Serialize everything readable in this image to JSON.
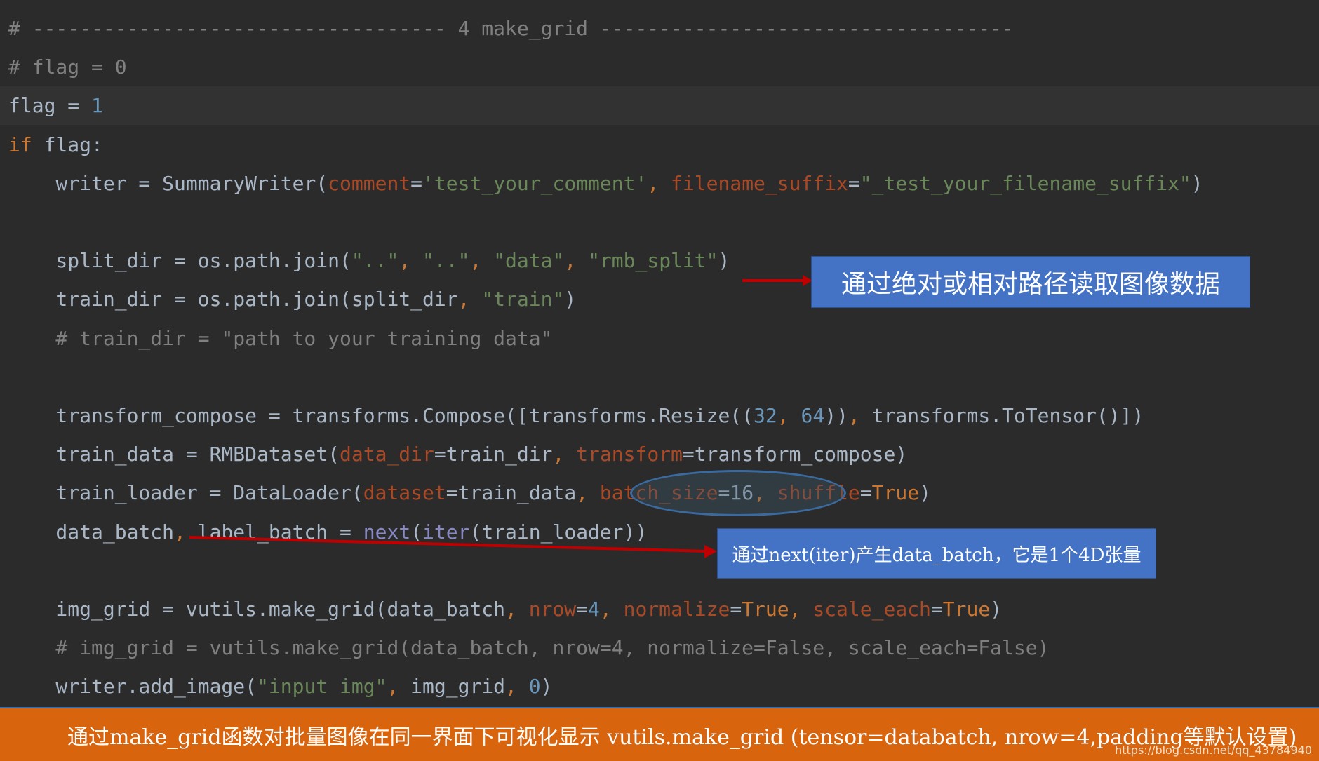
{
  "colors": {
    "background": "#2b2b2b",
    "current_line": "#323232",
    "default_text": "#a9b7c6",
    "comment": "#808080",
    "keyword": "#cc7832",
    "string": "#6a8759",
    "number": "#6897bb",
    "param": "#aa4926",
    "builtin": "#8888c6",
    "callout_blue": "#4472c4",
    "arrow_red": "#c00000",
    "banner_orange": "#d8640e"
  },
  "code_lines": [
    [
      {
        "t": "# ----------------------------------- 4 make_grid -----------------------------------",
        "c": "comment"
      }
    ],
    [
      {
        "t": "# flag = 0",
        "c": "comment"
      }
    ],
    [
      {
        "t": "flag",
        "c": "default"
      },
      {
        "t": " = ",
        "c": "default"
      },
      {
        "t": "1",
        "c": "number"
      }
    ],
    [
      {
        "t": "if ",
        "c": "keyword"
      },
      {
        "t": "flag:",
        "c": "default"
      }
    ],
    [
      {
        "t": "    writer = SummaryWriter(",
        "c": "default"
      },
      {
        "t": "comment",
        "c": "param"
      },
      {
        "t": "=",
        "c": "default"
      },
      {
        "t": "'test_your_comment'",
        "c": "string"
      },
      {
        "t": ", ",
        "c": "keyword"
      },
      {
        "t": "filename_suffix",
        "c": "param"
      },
      {
        "t": "=",
        "c": "default"
      },
      {
        "t": "\"_test_your_filename_suffix\"",
        "c": "string"
      },
      {
        "t": ")",
        "c": "default"
      }
    ],
    [],
    [
      {
        "t": "    split_dir = os.path.join(",
        "c": "default"
      },
      {
        "t": "\"..\"",
        "c": "string"
      },
      {
        "t": ", ",
        "c": "keyword"
      },
      {
        "t": "\"..\"",
        "c": "string"
      },
      {
        "t": ", ",
        "c": "keyword"
      },
      {
        "t": "\"data\"",
        "c": "string"
      },
      {
        "t": ", ",
        "c": "keyword"
      },
      {
        "t": "\"rmb_split\"",
        "c": "string"
      },
      {
        "t": ")",
        "c": "default"
      }
    ],
    [
      {
        "t": "    train_dir = os.path.join(split_dir",
        "c": "default"
      },
      {
        "t": ", ",
        "c": "keyword"
      },
      {
        "t": "\"train\"",
        "c": "string"
      },
      {
        "t": ")",
        "c": "default"
      }
    ],
    [
      {
        "t": "    # train_dir = \"path to your training data\"",
        "c": "comment"
      }
    ],
    [],
    [
      {
        "t": "    transform_compose = transforms.Compose([transforms.Resize((",
        "c": "default"
      },
      {
        "t": "32",
        "c": "number"
      },
      {
        "t": ", ",
        "c": "keyword"
      },
      {
        "t": "64",
        "c": "number"
      },
      {
        "t": "))",
        "c": "default"
      },
      {
        "t": ", ",
        "c": "keyword"
      },
      {
        "t": "transforms.ToTensor()])",
        "c": "default"
      }
    ],
    [
      {
        "t": "    train_data = RMBDataset(",
        "c": "default"
      },
      {
        "t": "data_dir",
        "c": "param"
      },
      {
        "t": "=train_dir",
        "c": "default"
      },
      {
        "t": ", ",
        "c": "keyword"
      },
      {
        "t": "transform",
        "c": "param"
      },
      {
        "t": "=transform_compose)",
        "c": "default"
      }
    ],
    [
      {
        "t": "    train_loader = DataLoader(",
        "c": "default"
      },
      {
        "t": "dataset",
        "c": "param"
      },
      {
        "t": "=train_data",
        "c": "default"
      },
      {
        "t": ", ",
        "c": "keyword"
      },
      {
        "t": "batch_size",
        "c": "param"
      },
      {
        "t": "=16",
        "c": "default"
      },
      {
        "t": ", ",
        "c": "keyword"
      },
      {
        "t": "shuffle",
        "c": "param"
      },
      {
        "t": "=",
        "c": "default"
      },
      {
        "t": "True",
        "c": "keyword"
      },
      {
        "t": ")",
        "c": "default"
      }
    ],
    [
      {
        "t": "    data_batch",
        "c": "default"
      },
      {
        "t": ", ",
        "c": "keyword"
      },
      {
        "t": "label_batch = ",
        "c": "default"
      },
      {
        "t": "next",
        "c": "builtin"
      },
      {
        "t": "(",
        "c": "default"
      },
      {
        "t": "iter",
        "c": "builtin"
      },
      {
        "t": "(train_loader))",
        "c": "default"
      }
    ],
    [],
    [
      {
        "t": "    img_grid = vutils.make_grid(data_batch",
        "c": "default"
      },
      {
        "t": ", ",
        "c": "keyword"
      },
      {
        "t": "nrow",
        "c": "param"
      },
      {
        "t": "=",
        "c": "default"
      },
      {
        "t": "4",
        "c": "number"
      },
      {
        "t": ", ",
        "c": "keyword"
      },
      {
        "t": "normalize",
        "c": "param"
      },
      {
        "t": "=",
        "c": "default"
      },
      {
        "t": "True",
        "c": "keyword"
      },
      {
        "t": ", ",
        "c": "keyword"
      },
      {
        "t": "scale_each",
        "c": "param"
      },
      {
        "t": "=",
        "c": "default"
      },
      {
        "t": "True",
        "c": "keyword"
      },
      {
        "t": ")",
        "c": "default"
      }
    ],
    [
      {
        "t": "    # img_grid = vutils.make_grid(data_batch, nrow=4, normalize=False, scale_each=False)",
        "c": "comment"
      }
    ],
    [
      {
        "t": "    writer.add_image(",
        "c": "default"
      },
      {
        "t": "\"input img\"",
        "c": "string"
      },
      {
        "t": ", ",
        "c": "keyword"
      },
      {
        "t": "img_grid",
        "c": "default"
      },
      {
        "t": ", ",
        "c": "keyword"
      },
      {
        "t": "0",
        "c": "number"
      },
      {
        "t": ")",
        "c": "default"
      }
    ]
  ],
  "callouts": {
    "read_images": "通过绝对或相对路径读取图像数据",
    "next_iter": "通过next(iter)产生data_batch，它是1个4D张量"
  },
  "banner": {
    "text": "通过make_grid函数对批量图像在同一界面下可视化显示 vutils.make_grid (tensor=databatch, nrow=4,padding等默认设置)",
    "watermark": "https://blog.csdn.net/qq_43784940"
  }
}
